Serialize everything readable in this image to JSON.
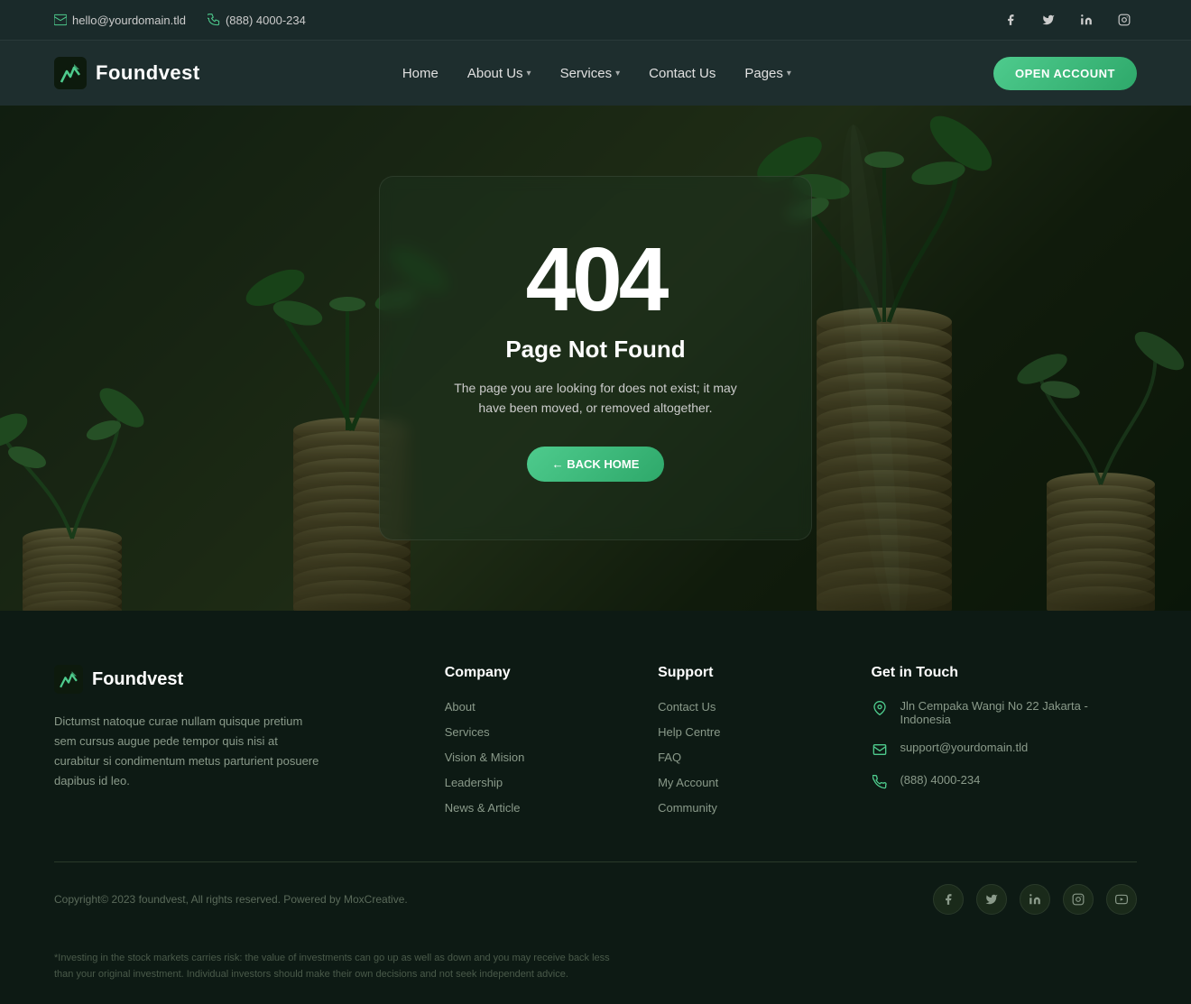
{
  "topbar": {
    "email": "hello@yourdomain.tld",
    "phone": "(888) 4000-234",
    "socials": [
      {
        "name": "facebook",
        "glyph": "f",
        "label": "Facebook"
      },
      {
        "name": "twitter",
        "glyph": "t",
        "label": "Twitter"
      },
      {
        "name": "linkedin",
        "glyph": "in",
        "label": "LinkedIn"
      },
      {
        "name": "instagram",
        "glyph": "ig",
        "label": "Instagram"
      }
    ]
  },
  "nav": {
    "logo_text": "Foundvest",
    "links": [
      {
        "label": "Home",
        "has_dropdown": false
      },
      {
        "label": "About Us",
        "has_dropdown": true
      },
      {
        "label": "Services",
        "has_dropdown": true
      },
      {
        "label": "Contact Us",
        "has_dropdown": false
      },
      {
        "label": "Pages",
        "has_dropdown": true
      }
    ],
    "cta_label": "OPEN ACCOUNT"
  },
  "error_page": {
    "code": "404",
    "title": "Page Not Found",
    "description": "The page you are looking for does not exist; it may have been moved, or removed altogether.",
    "back_label": "← BACK HOME"
  },
  "footer": {
    "logo_text": "Foundvest",
    "description": "Dictumst natoque curae nullam quisque pretium sem cursus augue pede tempor quis nisi at curabitur si condimentum metus parturient posuere dapibus id leo.",
    "columns": [
      {
        "heading": "Company",
        "links": [
          "About",
          "Services",
          "Vision & Mision",
          "Leadership",
          "News & Article"
        ]
      },
      {
        "heading": "Support",
        "links": [
          "Contact Us",
          "Help Centre",
          "FAQ",
          "My Account",
          "Community"
        ]
      }
    ],
    "get_in_touch": {
      "heading": "Get in Touch",
      "address": "Jln Cempaka Wangi No 22 Jakarta - Indonesia",
      "email": "support@yourdomain.tld",
      "phone": "(888) 4000-234"
    },
    "copyright": "Copyright© 2023 foundvest, All rights reserved. Powered by MoxCreative.",
    "disclaimer": "*Investing in the stock markets carries risk: the value of investments can go up as well as down and you may receive back less than your original investment. Individual investors should make their own decisions and not seek independent advice.",
    "socials": [
      {
        "name": "facebook-footer",
        "glyph": "f"
      },
      {
        "name": "twitter-footer",
        "glyph": "𝕏"
      },
      {
        "name": "linkedin-footer",
        "glyph": "in"
      },
      {
        "name": "instagram-footer",
        "glyph": "◻"
      },
      {
        "name": "youtube-footer",
        "glyph": "▶"
      }
    ]
  }
}
